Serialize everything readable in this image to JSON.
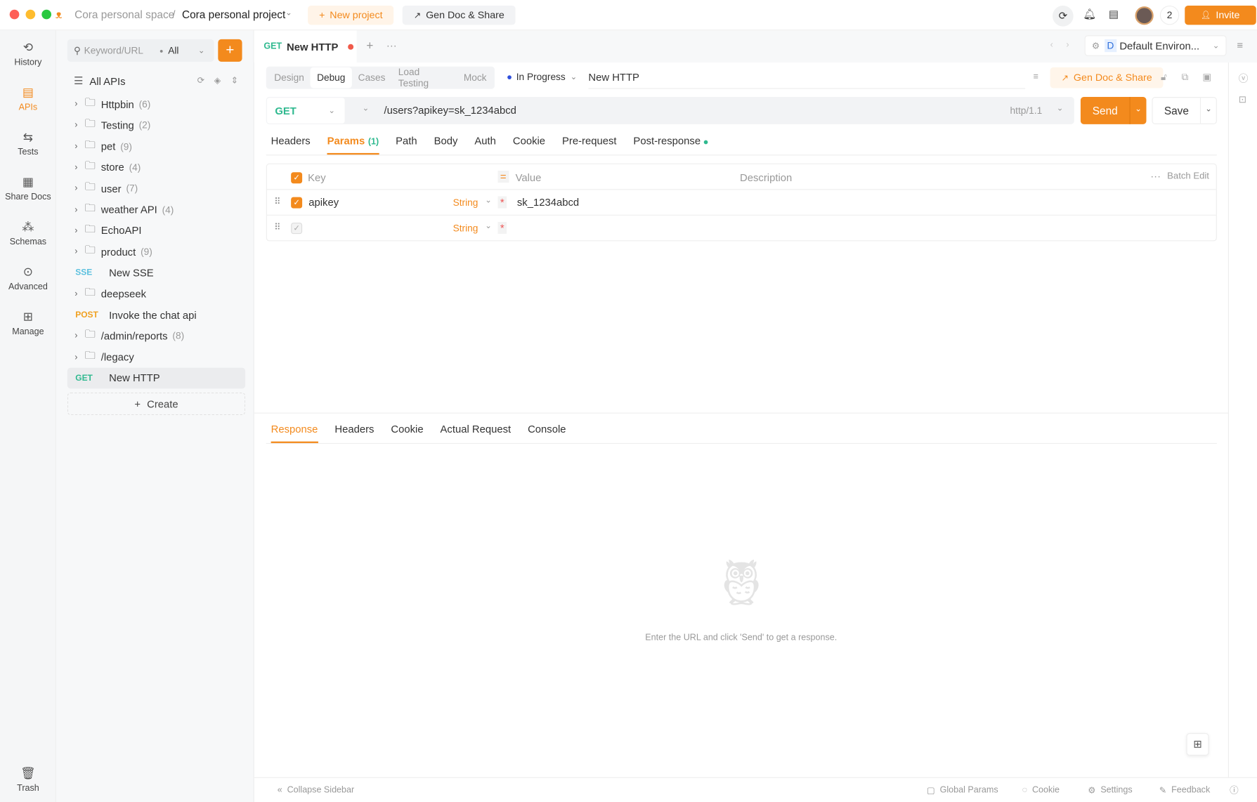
{
  "titlebar": {
    "workspace": "Cora personal space",
    "separator": "/",
    "project": "Cora personal project",
    "new_project": "New project",
    "gen_doc": "Gen Doc & Share",
    "member_count": "2",
    "invite": "Invite"
  },
  "leftnav": [
    {
      "label": "History",
      "icon": "history-icon"
    },
    {
      "label": "APIs",
      "icon": "apis-icon",
      "active": true
    },
    {
      "label": "Tests",
      "icon": "tests-icon"
    },
    {
      "label": "Share Docs",
      "icon": "share-docs-icon"
    },
    {
      "label": "Schemas",
      "icon": "schemas-icon"
    },
    {
      "label": "Advanced",
      "icon": "advanced-icon"
    },
    {
      "label": "Manage",
      "icon": "manage-icon"
    }
  ],
  "trash": "Trash",
  "sidebar": {
    "search_placeholder": "Keyword/URL",
    "filter": "All",
    "all_apis": "All APIs",
    "create": "Create",
    "items": [
      {
        "type": "folder",
        "label": "Httpbin",
        "count": "(6)"
      },
      {
        "type": "folder",
        "label": "Testing",
        "count": "(2)"
      },
      {
        "type": "folder",
        "label": "pet",
        "count": "(9)"
      },
      {
        "type": "folder",
        "label": "store",
        "count": "(4)"
      },
      {
        "type": "folder",
        "label": "user",
        "count": "(7)"
      },
      {
        "type": "folder",
        "label": "weather API",
        "count": "(4)"
      },
      {
        "type": "folder",
        "label": "EchoAPI",
        "count": ""
      },
      {
        "type": "folder",
        "label": "product",
        "count": "(9)"
      },
      {
        "type": "api",
        "method": "SSE",
        "label": "New SSE"
      },
      {
        "type": "folder",
        "label": "deepseek",
        "count": ""
      },
      {
        "type": "api",
        "method": "POST",
        "label": "Invoke the chat api"
      },
      {
        "type": "folder",
        "label": "/admin/reports",
        "count": "(8)"
      },
      {
        "type": "folder",
        "label": "/legacy",
        "count": ""
      },
      {
        "type": "api",
        "method": "GET",
        "label": "New HTTP",
        "selected": true
      }
    ]
  },
  "tab": {
    "method": "GET",
    "title": "New HTTP"
  },
  "environment": {
    "badge": "D",
    "name": "Default Environ..."
  },
  "modes": [
    "Design",
    "Debug",
    "Cases",
    "Load Testing",
    "Mock"
  ],
  "active_mode": "Debug",
  "status": "In Progress",
  "api_name": "New HTTP",
  "gen_doc": "Gen Doc & Share",
  "request": {
    "method": "GET",
    "url": "/users?apikey=sk_1234abcd",
    "protocol": "http/1.1",
    "send": "Send",
    "save": "Save"
  },
  "request_tabs": [
    "Headers",
    "Params",
    "Path",
    "Body",
    "Auth",
    "Cookie",
    "Pre-request",
    "Post-response"
  ],
  "params_count": "(1)",
  "params": {
    "headers": {
      "key": "Key",
      "value": "Value",
      "description": "Description",
      "batch_edit": "Batch Edit"
    },
    "rows": [
      {
        "checked": true,
        "key": "apikey",
        "type": "String",
        "value": "sk_1234abcd"
      },
      {
        "checked": false,
        "key": "",
        "type": "String",
        "value": ""
      }
    ]
  },
  "response_tabs": [
    "Response",
    "Headers",
    "Cookie",
    "Actual Request",
    "Console"
  ],
  "empty_message": "Enter the URL and click 'Send' to get a response.",
  "bottombar": {
    "collapse": "Collapse Sidebar",
    "global_params": "Global Params",
    "cookie": "Cookie",
    "settings": "Settings",
    "feedback": "Feedback"
  },
  "colors": {
    "accent": "#f38a1d",
    "get": "#2fb98f",
    "post": "#f0a020",
    "sse": "#5bc0de"
  }
}
